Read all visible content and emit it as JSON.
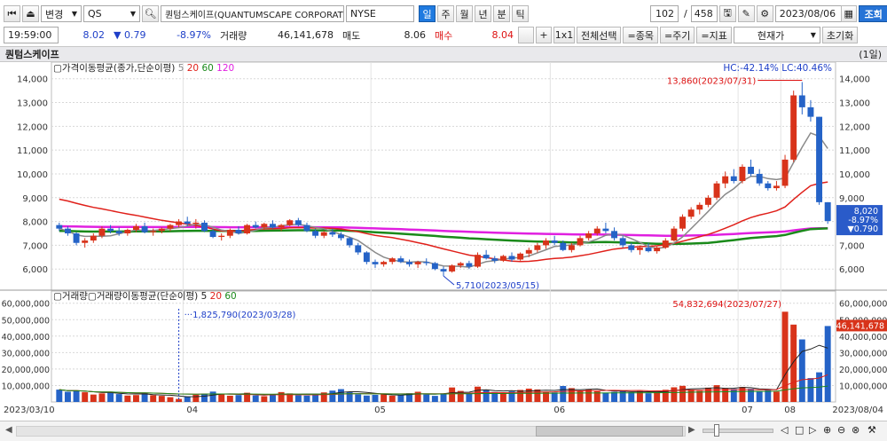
{
  "toolbar": {
    "code_label": "변경",
    "symbol": "QS",
    "company_name": "퀀텀스케이프(QUANTUMSCAPE CORPORATION)",
    "exchange": "NYSE",
    "periods": [
      "일",
      "주",
      "월",
      "년",
      "분",
      "틱"
    ],
    "active_period": "일",
    "count_current": "102",
    "count_sep": "/",
    "count_total": "458",
    "date": "2023/08/06",
    "query_label": "조회"
  },
  "quote": {
    "time": "19:59:00",
    "price": "8.02",
    "change": "▼ 0.79",
    "change_pct": "-8.97%",
    "volume_label": "거래량",
    "volume": "46,141,678",
    "sell_label": "매도",
    "sell_price": "8.06",
    "buy_label": "매수",
    "buy_price": "8.04",
    "plus_label": "+",
    "ratio_label": "1x1",
    "select_all_label": "전체선택",
    "item_label": "=종목",
    "cycle_label": "=주기",
    "indicator_label": "=지표",
    "current_label": "현재가",
    "reset_label": "초기화"
  },
  "chart_header": {
    "name": "퀀텀스케이프",
    "period_tag": "(1일)"
  },
  "price_panel": {
    "legend_title": "가격이동평균(종가,단순이평)",
    "ma_periods": [
      "5",
      "20",
      "60",
      "120"
    ],
    "hc_lc": "HC:-42.14%  LC:40.46%",
    "high_annotation": "13,860(2023/07/31)",
    "low_annotation": "5,710(2023/05/15)",
    "current_box": [
      "8,020",
      "-8.97%",
      "▼0.790"
    ],
    "ticks": [
      "14,000",
      "13,000",
      "12,000",
      "11,000",
      "10,000",
      "9,000",
      "8,000",
      "7,000",
      "6,000"
    ]
  },
  "volume_panel": {
    "legend_title": "거래량",
    "legend_title2": "거래량이동평균(단순이평)",
    "ma_periods": [
      "5",
      "20",
      "60"
    ],
    "min_annotation": "1,825,790(2023/03/28)",
    "max_annotation": "54,832,694(2023/07/27)",
    "current_value": "46,141,678",
    "ticks": [
      "60,000,000",
      "50,000,000",
      "40,000,000",
      "30,000,000",
      "20,000,000",
      "10,000,000"
    ]
  },
  "x_axis": {
    "start": "2023/03/10",
    "end": "2023/08/04",
    "months": [
      "04",
      "05",
      "06",
      "07",
      "08"
    ]
  },
  "colors": {
    "up": "#d8331a",
    "down": "#2563c7",
    "ma5": "#8a8a8a",
    "ma20": "#e0201a",
    "ma60": "#1a8a1a",
    "ma120": "#e020e0"
  },
  "chart_data": {
    "type": "candlestick",
    "date_range": [
      "2023/03/10",
      "2023/08/04"
    ],
    "ohlc": [
      [
        7.85,
        7.95,
        7.6,
        7.7
      ],
      [
        7.7,
        7.8,
        7.4,
        7.5
      ],
      [
        7.5,
        7.55,
        7.0,
        7.1
      ],
      [
        7.1,
        7.3,
        6.9,
        7.2
      ],
      [
        7.2,
        7.5,
        7.1,
        7.4
      ],
      [
        7.4,
        7.8,
        7.3,
        7.7
      ],
      [
        7.7,
        7.85,
        7.5,
        7.6
      ],
      [
        7.6,
        7.75,
        7.4,
        7.5
      ],
      [
        7.5,
        7.7,
        7.4,
        7.65
      ],
      [
        7.65,
        7.9,
        7.55,
        7.8
      ],
      [
        7.8,
        7.95,
        7.5,
        7.55
      ],
      [
        7.55,
        7.7,
        7.4,
        7.6
      ],
      [
        7.6,
        7.75,
        7.5,
        7.7
      ],
      [
        7.7,
        7.9,
        7.6,
        7.85
      ],
      [
        7.85,
        8.1,
        7.75,
        8.0
      ],
      [
        8.0,
        8.2,
        7.8,
        7.9
      ],
      [
        7.9,
        8.1,
        7.7,
        7.95
      ],
      [
        7.95,
        8.05,
        7.55,
        7.6
      ],
      [
        7.6,
        7.7,
        7.3,
        7.35
      ],
      [
        7.35,
        7.5,
        7.2,
        7.4
      ],
      [
        7.4,
        7.7,
        7.3,
        7.65
      ],
      [
        7.65,
        7.8,
        7.45,
        7.5
      ],
      [
        7.5,
        7.9,
        7.45,
        7.85
      ],
      [
        7.85,
        8.0,
        7.7,
        7.75
      ],
      [
        7.75,
        7.95,
        7.65,
        7.9
      ],
      [
        7.9,
        8.05,
        7.7,
        7.75
      ],
      [
        7.75,
        7.9,
        7.6,
        7.85
      ],
      [
        7.85,
        8.1,
        7.8,
        8.05
      ],
      [
        8.05,
        8.15,
        7.8,
        7.85
      ],
      [
        7.85,
        7.95,
        7.55,
        7.6
      ],
      [
        7.6,
        7.7,
        7.3,
        7.4
      ],
      [
        7.4,
        7.6,
        7.3,
        7.55
      ],
      [
        7.55,
        7.7,
        7.35,
        7.45
      ],
      [
        7.45,
        7.55,
        7.2,
        7.3
      ],
      [
        7.3,
        7.35,
        6.9,
        7.0
      ],
      [
        7.0,
        7.1,
        6.6,
        6.7
      ],
      [
        6.7,
        6.75,
        6.2,
        6.3
      ],
      [
        6.3,
        6.4,
        6.05,
        6.2
      ],
      [
        6.2,
        6.35,
        6.1,
        6.3
      ],
      [
        6.3,
        6.5,
        6.2,
        6.45
      ],
      [
        6.45,
        6.55,
        6.25,
        6.3
      ],
      [
        6.3,
        6.4,
        6.1,
        6.2
      ],
      [
        6.2,
        6.35,
        6.05,
        6.3
      ],
      [
        6.3,
        6.45,
        6.15,
        6.25
      ],
      [
        6.25,
        6.3,
        5.95,
        6.0
      ],
      [
        6.0,
        6.1,
        5.71,
        5.9
      ],
      [
        5.9,
        6.2,
        5.85,
        6.15
      ],
      [
        6.15,
        6.3,
        6.05,
        6.25
      ],
      [
        6.25,
        6.35,
        6.0,
        6.1
      ],
      [
        6.1,
        6.7,
        6.05,
        6.6
      ],
      [
        6.6,
        6.8,
        6.4,
        6.45
      ],
      [
        6.45,
        6.55,
        6.25,
        6.35
      ],
      [
        6.35,
        6.6,
        6.3,
        6.55
      ],
      [
        6.55,
        6.7,
        6.3,
        6.4
      ],
      [
        6.4,
        6.7,
        6.35,
        6.65
      ],
      [
        6.65,
        6.9,
        6.5,
        6.8
      ],
      [
        6.8,
        7.1,
        6.7,
        7.0
      ],
      [
        7.0,
        7.3,
        6.85,
        7.2
      ],
      [
        7.2,
        7.4,
        7.0,
        7.1
      ],
      [
        7.1,
        7.2,
        6.75,
        6.8
      ],
      [
        6.8,
        7.1,
        6.7,
        7.0
      ],
      [
        7.0,
        7.4,
        6.95,
        7.3
      ],
      [
        7.3,
        7.6,
        7.2,
        7.5
      ],
      [
        7.5,
        7.8,
        7.4,
        7.7
      ],
      [
        7.7,
        7.95,
        7.5,
        7.6
      ],
      [
        7.6,
        7.75,
        7.2,
        7.3
      ],
      [
        7.3,
        7.4,
        6.9,
        7.0
      ],
      [
        7.0,
        7.1,
        6.7,
        6.8
      ],
      [
        6.8,
        7.0,
        6.6,
        6.9
      ],
      [
        6.9,
        7.1,
        6.7,
        6.75
      ],
      [
        6.75,
        6.95,
        6.65,
        6.9
      ],
      [
        6.9,
        7.3,
        6.85,
        7.2
      ],
      [
        7.2,
        7.8,
        7.15,
        7.7
      ],
      [
        7.7,
        8.3,
        7.6,
        8.2
      ],
      [
        8.2,
        8.6,
        8.1,
        8.5
      ],
      [
        8.5,
        8.8,
        8.3,
        8.7
      ],
      [
        8.7,
        9.1,
        8.6,
        9.0
      ],
      [
        9.0,
        9.7,
        8.9,
        9.6
      ],
      [
        9.6,
        10.1,
        9.4,
        9.9
      ],
      [
        9.9,
        10.2,
        9.6,
        9.7
      ],
      [
        9.7,
        10.4,
        9.6,
        10.3
      ],
      [
        10.3,
        10.6,
        9.9,
        10.0
      ],
      [
        10.0,
        10.2,
        9.5,
        9.6
      ],
      [
        9.6,
        9.7,
        9.3,
        9.4
      ],
      [
        9.4,
        9.7,
        9.3,
        9.5
      ],
      [
        9.5,
        10.8,
        9.4,
        10.6
      ],
      [
        10.6,
        13.5,
        10.5,
        13.3
      ],
      [
        13.3,
        13.86,
        12.5,
        12.8
      ],
      [
        12.8,
        13.1,
        12.2,
        12.4
      ],
      [
        12.4,
        12.4,
        8.7,
        8.81
      ],
      [
        8.81,
        8.81,
        7.9,
        8.02
      ]
    ],
    "volume_millions": [
      7.5,
      6.2,
      6.8,
      5.9,
      4.5,
      5.2,
      6.1,
      4.8,
      3.9,
      4.2,
      5.5,
      4.1,
      3.7,
      2.9,
      1.83,
      3.3,
      4.4,
      5.1,
      6.3,
      4.9,
      3.8,
      4.2,
      5.6,
      4.0,
      3.5,
      4.8,
      6.0,
      5.2,
      4.1,
      3.9,
      4.7,
      5.8,
      6.9,
      7.8,
      5.9,
      4.6,
      3.9,
      4.3,
      5.0,
      3.8,
      4.1,
      5.3,
      6.2,
      4.5,
      3.7,
      5.1,
      8.8,
      6.7,
      5.4,
      9.3,
      7.1,
      6.0,
      5.5,
      6.4,
      7.3,
      8.1,
      7.6,
      6.2,
      5.8,
      9.7,
      8.4,
      6.9,
      7.8,
      6.5,
      5.7,
      6.1,
      7.0,
      5.9,
      6.6,
      5.3,
      6.0,
      7.4,
      8.9,
      9.8,
      7.5,
      6.8,
      8.7,
      10.2,
      8.3,
      7.9,
      9.1,
      8.0,
      6.7,
      7.2,
      6.3,
      54.83,
      47.0,
      38.0,
      14.5,
      18.0,
      46.14
    ],
    "ylim": [
      5.3,
      14.4
    ],
    "ma_series": [
      "MA5",
      "MA20",
      "MA60",
      "MA120"
    ],
    "volume_ylim": [
      0,
      62000000
    ]
  },
  "scrollbar": {
    "left_arrow": "◀",
    "right_arrow": "▶"
  }
}
